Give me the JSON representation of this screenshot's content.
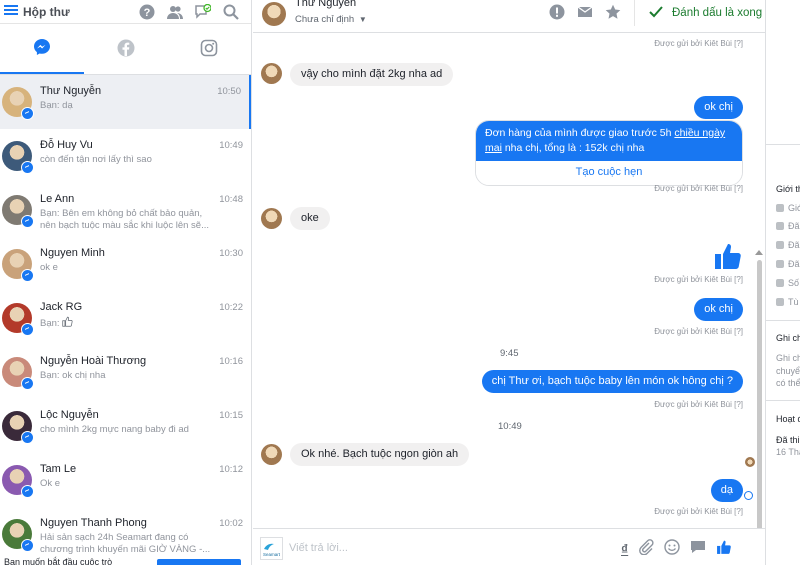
{
  "inbox": {
    "title": "Hộp thư",
    "icons": [
      "question-icon",
      "people-icon",
      "chat-check-icon",
      "search-icon"
    ],
    "channels": [
      "messenger-tab",
      "facebook-tab",
      "instagram-tab"
    ],
    "conversations": [
      {
        "name": "Thư Nguyễn",
        "snippet": "Bạn: dạ",
        "time": "10:50",
        "selected": true,
        "avatar_color": "#d7b37c"
      },
      {
        "name": "Đỗ Huy Vu",
        "snippet": "còn đến tận nơi lấy thì sao",
        "time": "10:49",
        "avatar_color": "#3d5a7a"
      },
      {
        "name": "Le Ann",
        "snippet": "Bạn: Bên em không bỏ chất bảo quản, nên bạch tuộc màu sắc khi luộc lên sẽ...",
        "time": "10:48",
        "avatar_color": "#7f7a72"
      },
      {
        "name": "Nguyen Minh",
        "snippet": "ok e",
        "time": "10:30",
        "avatar_color": "#c9a27a"
      },
      {
        "name": "Jack RG",
        "snippet": "Bạn:",
        "time": "10:22",
        "avatar_color": "#b33a2a"
      },
      {
        "name": "Nguyễn Hoài Thương",
        "snippet": "Bạn: ok chị nha",
        "time": "10:16",
        "avatar_color": "#c98a7a"
      },
      {
        "name": "Lộc Nguyễn",
        "snippet": "cho mình 2kg mực nang baby đi ad",
        "time": "10:15",
        "avatar_color": "#3a2a3a"
      },
      {
        "name": "Tam Le",
        "snippet": "Ok e",
        "time": "10:12",
        "avatar_color": "#8a5ab0"
      },
      {
        "name": "Nguyen Thanh Phong",
        "snippet": "Hải sản sạch 24h Seamart đang có chương trình khuyến mãi GIỜ VÀNG -...",
        "time": "10:02",
        "avatar_color": "#4a7a3a"
      }
    ],
    "footer_text": "Bạn muốn bắt đầu cuộc trò"
  },
  "chat": {
    "contact_name": "Thư Nguyễn",
    "assignee": "Chưa chỉ định",
    "done_label": "Đánh dấu là xong",
    "sent_by": "Được gửi bởi Kiêt Bùi [?]",
    "messages": {
      "m1": "vậy cho mình đặt 2kg nha ad",
      "m2": "ok chị",
      "card_pre": "Đơn hàng của mình được giao trước 5h ",
      "card_link": "chiều ngày mai",
      "card_post": " nha chị, tổng là : 152k chị nha",
      "card_button": "Tạo cuộc hẹn",
      "m3": "oke",
      "m4": "ok chị",
      "time1": "9:45",
      "m5": "chị Thư ơi, bạch tuộc baby lên món ok hông chị ?",
      "time2": "10:49",
      "m6": "Ok nhé. Bạch tuộc ngon giòn ah",
      "m7": "dạ"
    },
    "compose_placeholder": "Viết trả lời...",
    "page_logo": "Seamart"
  },
  "details": {
    "about": "Giới th",
    "rows": [
      "Giớ",
      "Đã",
      "Đã",
      "Đã",
      "Số",
      "Tù"
    ],
    "notes_title": "Ghi ch",
    "notes_text": [
      "Ghi ch",
      "chuyể",
      "có thể"
    ],
    "activity_title": "Hoạt đ",
    "activity_line1": "Đã thi",
    "activity_line2": "16 Tha"
  },
  "colors": {
    "accent": "#1877f2",
    "done": "#1c7c2f",
    "bubble_in": "#f1f0f0"
  }
}
